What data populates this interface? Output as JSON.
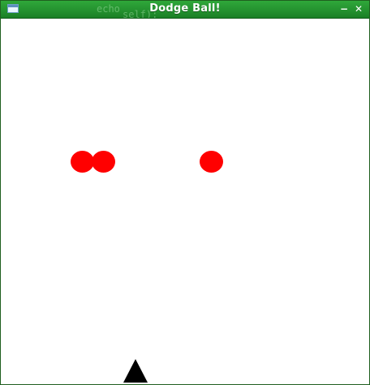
{
  "window": {
    "title": "Dodge Ball!",
    "minimize_glyph": "−",
    "close_glyph": "✕",
    "icon": "window-icon",
    "background_text_line1": "echo",
    "background_text_line2": "self):"
  },
  "game": {
    "ball_color": "#ff0000",
    "player_color": "#000000",
    "background_color": "#ffffff",
    "balls": [
      {
        "id": 1,
        "shape": "circle"
      },
      {
        "id": 2,
        "shape": "circle"
      },
      {
        "id": 3,
        "shape": "circle"
      }
    ],
    "player": {
      "shape": "triangle"
    }
  }
}
